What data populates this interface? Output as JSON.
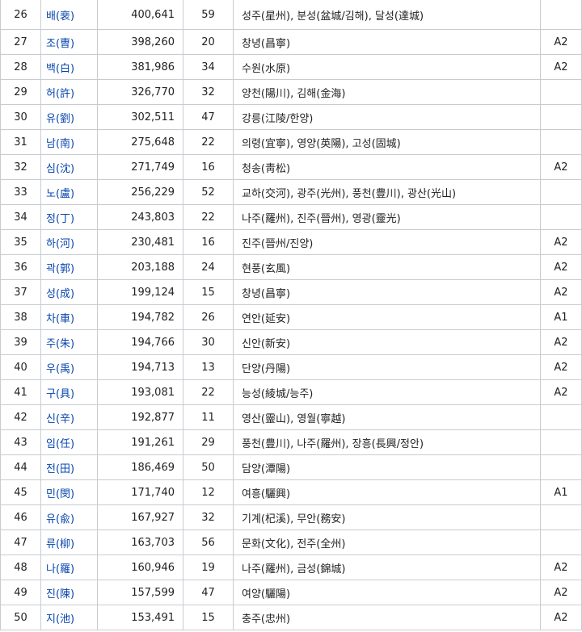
{
  "rows": [
    {
      "rank": "26",
      "surname": "배(裵)",
      "population": "400,641",
      "clans": "59",
      "origin": "성주(星州), 분성(盆城/김해), 달성(達城)",
      "grade": ""
    },
    {
      "rank": "27",
      "surname": "조(曺)",
      "population": "398,260",
      "clans": "20",
      "origin": "창녕(昌寧)",
      "grade": "A2"
    },
    {
      "rank": "28",
      "surname": "백(白)",
      "population": "381,986",
      "clans": "34",
      "origin": "수원(水原)",
      "grade": "A2"
    },
    {
      "rank": "29",
      "surname": "허(許)",
      "population": "326,770",
      "clans": "32",
      "origin": "양천(陽川), 김해(金海)",
      "grade": ""
    },
    {
      "rank": "30",
      "surname": "유(劉)",
      "population": "302,511",
      "clans": "47",
      "origin": "강릉(江陵/한양)",
      "grade": ""
    },
    {
      "rank": "31",
      "surname": "남(南)",
      "population": "275,648",
      "clans": "22",
      "origin": "의령(宜寧), 영양(英陽), 고성(固城)",
      "grade": ""
    },
    {
      "rank": "32",
      "surname": "심(沈)",
      "population": "271,749",
      "clans": "16",
      "origin": "청송(靑松)",
      "grade": "A2"
    },
    {
      "rank": "33",
      "surname": "노(盧)",
      "population": "256,229",
      "clans": "52",
      "origin": "교하(交河), 광주(光州), 풍천(豊川), 광산(光山)",
      "grade": ""
    },
    {
      "rank": "34",
      "surname": "정(丁)",
      "population": "243,803",
      "clans": "22",
      "origin": "나주(羅州), 진주(晉州), 영광(靈光)",
      "grade": ""
    },
    {
      "rank": "35",
      "surname": "하(河)",
      "population": "230,481",
      "clans": "16",
      "origin": "진주(晉州/진양)",
      "grade": "A2"
    },
    {
      "rank": "36",
      "surname": "곽(郭)",
      "population": "203,188",
      "clans": "24",
      "origin": "현풍(玄風)",
      "grade": "A2"
    },
    {
      "rank": "37",
      "surname": "성(成)",
      "population": "199,124",
      "clans": "15",
      "origin": "창녕(昌寧)",
      "grade": "A2"
    },
    {
      "rank": "38",
      "surname": "차(車)",
      "population": "194,782",
      "clans": "26",
      "origin": "연안(延安)",
      "grade": "A1"
    },
    {
      "rank": "39",
      "surname": "주(朱)",
      "population": "194,766",
      "clans": "30",
      "origin": "신안(新安)",
      "grade": "A2"
    },
    {
      "rank": "40",
      "surname": "우(禹)",
      "population": "194,713",
      "clans": "13",
      "origin": "단양(丹陽)",
      "grade": "A2"
    },
    {
      "rank": "41",
      "surname": "구(具)",
      "population": "193,081",
      "clans": "22",
      "origin": "능성(綾城/능주)",
      "grade": "A2"
    },
    {
      "rank": "42",
      "surname": "신(辛)",
      "population": "192,877",
      "clans": "11",
      "origin": "영산(靈山), 영월(寧越)",
      "grade": ""
    },
    {
      "rank": "43",
      "surname": "임(任)",
      "population": "191,261",
      "clans": "29",
      "origin": "풍천(豊川), 나주(羅州), 장흥(長興/정안)",
      "grade": ""
    },
    {
      "rank": "44",
      "surname": "전(田)",
      "population": "186,469",
      "clans": "50",
      "origin": "담양(潭陽)",
      "grade": ""
    },
    {
      "rank": "45",
      "surname": "민(閔)",
      "population": "171,740",
      "clans": "12",
      "origin": "여흥(驪興)",
      "grade": "A1"
    },
    {
      "rank": "46",
      "surname": "유(兪)",
      "population": "167,927",
      "clans": "32",
      "origin": "기계(杞溪), 무안(務安)",
      "grade": ""
    },
    {
      "rank": "47",
      "surname": "류(柳)",
      "population": "163,703",
      "clans": "56",
      "origin": "문화(文化), 전주(全州)",
      "grade": ""
    },
    {
      "rank": "48",
      "surname": "나(羅)",
      "population": "160,946",
      "clans": "19",
      "origin": "나주(羅州), 금성(錦城)",
      "grade": "A2"
    },
    {
      "rank": "49",
      "surname": "진(陳)",
      "population": "157,599",
      "clans": "47",
      "origin": "여양(驪陽)",
      "grade": "A2"
    },
    {
      "rank": "50",
      "surname": "지(池)",
      "population": "153,491",
      "clans": "15",
      "origin": "충주(忠州)",
      "grade": "A2"
    }
  ]
}
